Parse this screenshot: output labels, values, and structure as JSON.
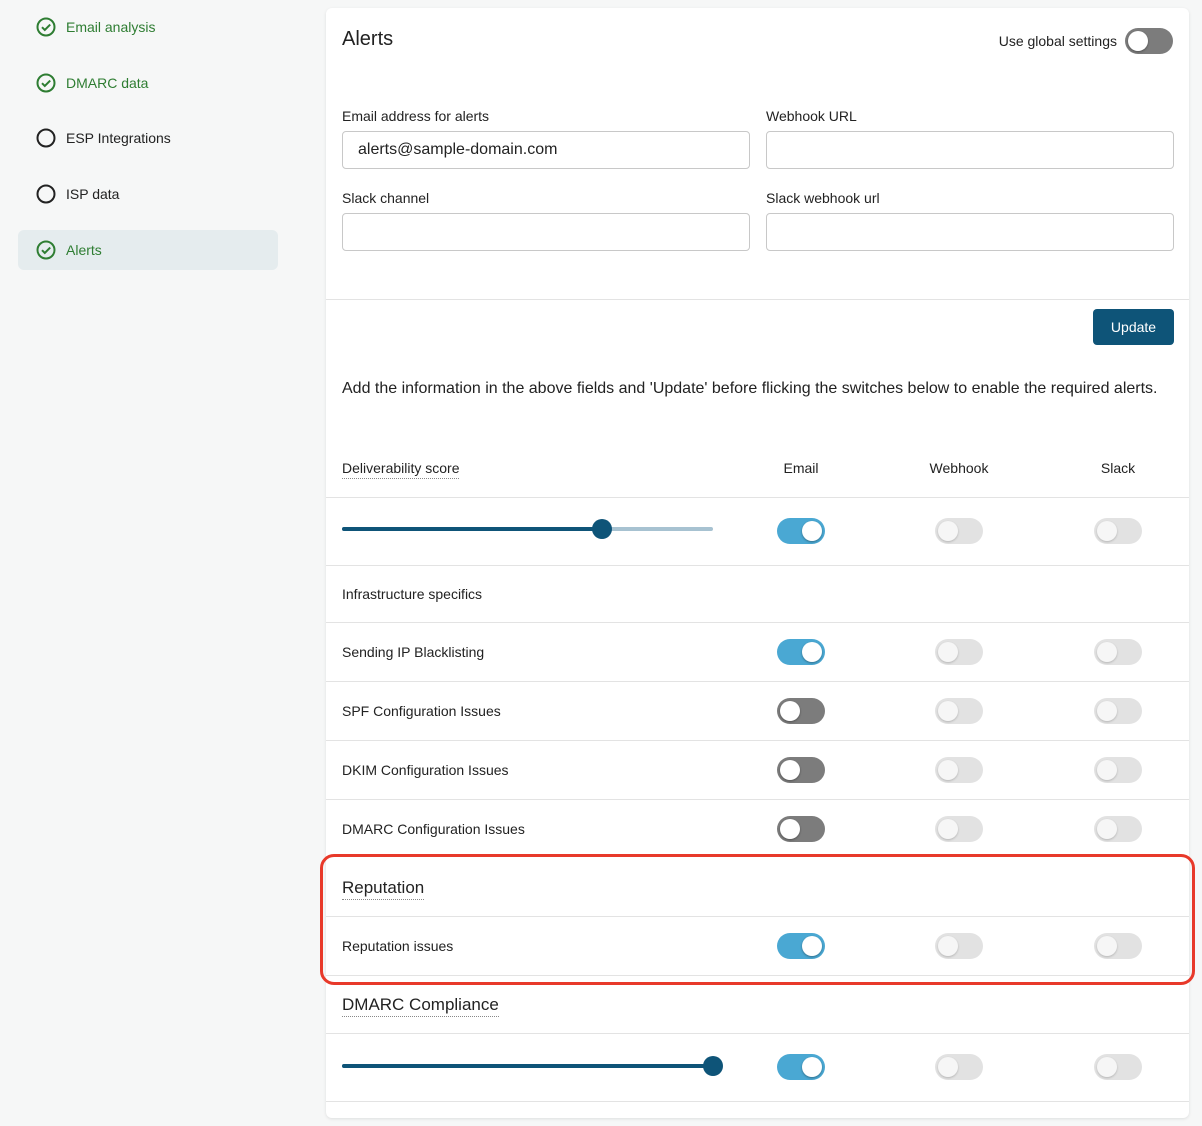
{
  "sidebar": {
    "items": [
      {
        "label": "Email analysis",
        "status": "done"
      },
      {
        "label": "DMARC data",
        "status": "done"
      },
      {
        "label": "ESP Integrations",
        "status": "todo"
      },
      {
        "label": "ISP data",
        "status": "todo"
      },
      {
        "label": "Alerts",
        "status": "done",
        "active": true
      }
    ]
  },
  "panel": {
    "title": "Alerts",
    "global_settings_label": "Use global settings",
    "global_settings_on": false
  },
  "form": {
    "email_label": "Email address for alerts",
    "email_value": "alerts@sample-domain.com",
    "webhook_label": "Webhook URL",
    "webhook_value": "",
    "slack_channel_label": "Slack channel",
    "slack_channel_value": "",
    "slack_webhook_label": "Slack webhook url",
    "slack_webhook_value": "",
    "update_label": "Update"
  },
  "info_text": "Add the information in the above fields and 'Update' before flicking the switches below to enable the required alerts.",
  "columns": {
    "email": "Email",
    "webhook": "Webhook",
    "slack": "Slack"
  },
  "deliverability": {
    "label": "Deliverability score",
    "slider_percent": 70,
    "email": "on",
    "webhook": "disabled",
    "slack": "disabled"
  },
  "infrastructure": {
    "label": "Infrastructure specifics",
    "rows": [
      {
        "label": "Sending IP Blacklisting",
        "email": "on",
        "webhook": "disabled",
        "slack": "disabled"
      },
      {
        "label": "SPF Configuration Issues",
        "email": "off",
        "webhook": "disabled",
        "slack": "disabled"
      },
      {
        "label": "DKIM Configuration Issues",
        "email": "off",
        "webhook": "disabled",
        "slack": "disabled"
      },
      {
        "label": "DMARC Configuration Issues",
        "email": "off",
        "webhook": "disabled",
        "slack": "disabled"
      }
    ]
  },
  "reputation": {
    "label": "Reputation",
    "rows": [
      {
        "label": "Reputation issues",
        "email": "on",
        "webhook": "disabled",
        "slack": "disabled"
      }
    ]
  },
  "dmarc_compliance": {
    "label": "DMARC Compliance",
    "slider_percent": 100,
    "email": "on",
    "webhook": "disabled",
    "slack": "disabled"
  },
  "colors": {
    "accent": "#0e5478",
    "toggle_on": "#4aa8d3",
    "done_green": "#2e7d32",
    "highlight_red": "#e8392a"
  }
}
